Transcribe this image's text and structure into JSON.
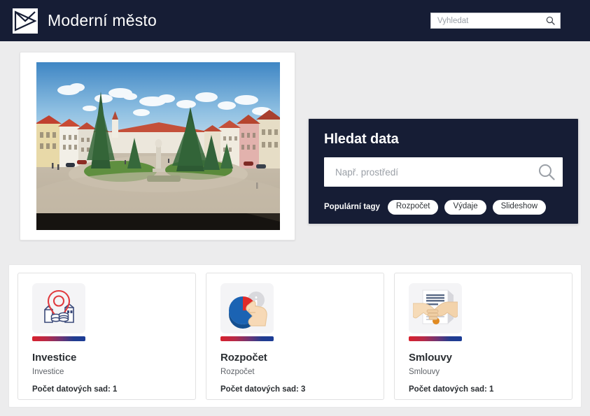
{
  "header": {
    "logo_icon": "envelope-bowtie-logo-icon",
    "title": "Moderní město",
    "search": {
      "placeholder": "Vyhledat",
      "value": "",
      "icon": "search-icon"
    }
  },
  "hero": {
    "photo": {
      "alt": "Fotografie historického náměstí s kašnou, stromy a barevnými domy",
      "icon": "town-square-photo"
    },
    "search_panel": {
      "title": "Hledat data",
      "search": {
        "placeholder": "Např. prostředí",
        "value": "",
        "icon": "search-icon"
      },
      "tags_label": "Populární tagy",
      "tags": [
        "Rozpočet",
        "Výdaje",
        "Slideshow"
      ]
    }
  },
  "categories": [
    {
      "title": "Investice",
      "subtitle": "Investice",
      "count_label": "Počet datových sad: 1",
      "icon": "map-pin-investment-icon"
    },
    {
      "title": "Rozpočet",
      "subtitle": "Rozpočet",
      "count_label": "Počet datových sad: 3",
      "icon": "pie-chart-hand-icon"
    },
    {
      "title": "Smlouvy",
      "subtitle": "Smlouvy",
      "count_label": "Počet datových sad: 1",
      "icon": "handshake-contract-icon"
    }
  ],
  "colors": {
    "navy": "#161d35",
    "page_bg": "#ececed",
    "accent_red": "#d8212d",
    "accent_blue": "#1b3c96",
    "card_border": "#e1e1e2"
  }
}
